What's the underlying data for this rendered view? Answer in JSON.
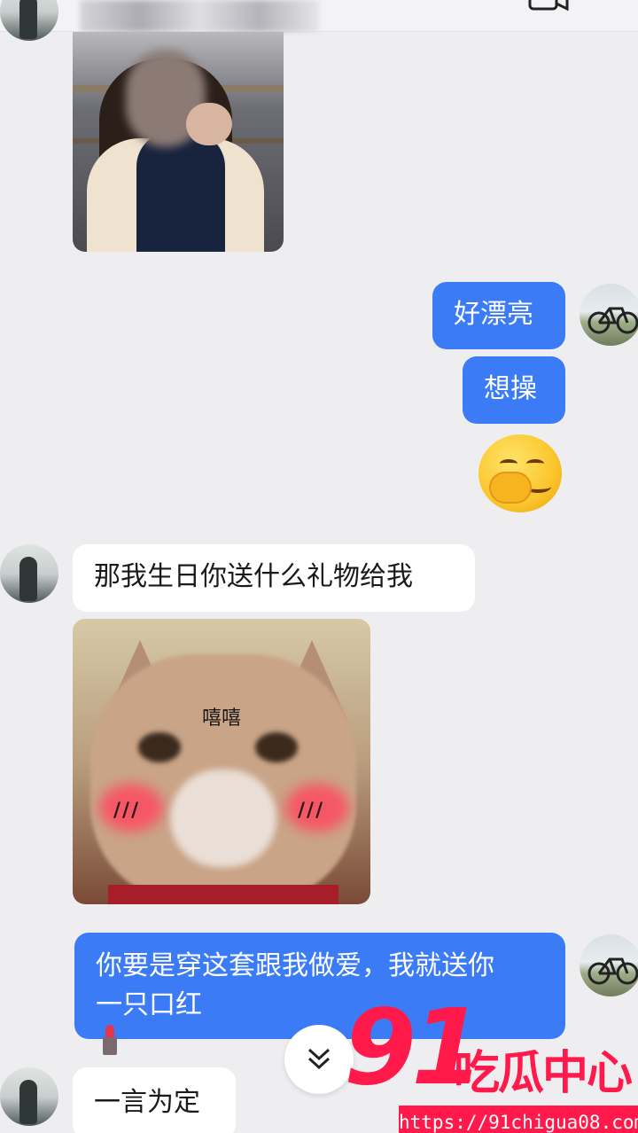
{
  "header": {
    "back_icon": "chevron-left-icon",
    "video_icon": "video-call-icon"
  },
  "messages": {
    "out_1": "好漂亮",
    "out_2": "想操",
    "emoji": "hand-over-mouth-emoji",
    "in_1": "那我生日你送什么礼物给我",
    "sticker_caption": "嘻嘻",
    "sticker_marks_left": "///",
    "sticker_marks_right": "///",
    "out_3_line1": "你要是穿这套跟我做爱，我就送你",
    "out_3_line2": "一只口红",
    "in_2": "一言为定"
  },
  "colors": {
    "outgoing_bubble": "#3b7cf6",
    "incoming_bubble": "#ffffff",
    "background": "#eeeef1",
    "watermark": "#ff1a4b"
  },
  "watermark": {
    "logo": "91",
    "title": "吃瓜中心",
    "url": "https://91chigua08.com"
  }
}
